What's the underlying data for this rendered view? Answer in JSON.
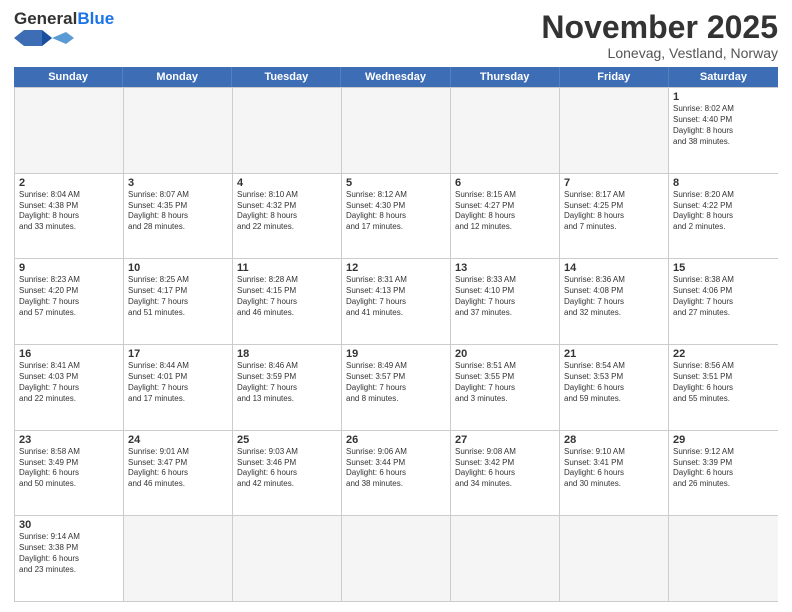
{
  "header": {
    "logo_general": "General",
    "logo_blue": "Blue",
    "title": "November 2025",
    "subtitle": "Lonevag, Vestland, Norway"
  },
  "weekdays": [
    "Sunday",
    "Monday",
    "Tuesday",
    "Wednesday",
    "Thursday",
    "Friday",
    "Saturday"
  ],
  "rows": [
    [
      {
        "day": "",
        "info": ""
      },
      {
        "day": "",
        "info": ""
      },
      {
        "day": "",
        "info": ""
      },
      {
        "day": "",
        "info": ""
      },
      {
        "day": "",
        "info": ""
      },
      {
        "day": "",
        "info": ""
      },
      {
        "day": "1",
        "info": "Sunrise: 8:02 AM\nSunset: 4:40 PM\nDaylight: 8 hours\nand 38 minutes."
      }
    ],
    [
      {
        "day": "2",
        "info": "Sunrise: 8:04 AM\nSunset: 4:38 PM\nDaylight: 8 hours\nand 33 minutes."
      },
      {
        "day": "3",
        "info": "Sunrise: 8:07 AM\nSunset: 4:35 PM\nDaylight: 8 hours\nand 28 minutes."
      },
      {
        "day": "4",
        "info": "Sunrise: 8:10 AM\nSunset: 4:32 PM\nDaylight: 8 hours\nand 22 minutes."
      },
      {
        "day": "5",
        "info": "Sunrise: 8:12 AM\nSunset: 4:30 PM\nDaylight: 8 hours\nand 17 minutes."
      },
      {
        "day": "6",
        "info": "Sunrise: 8:15 AM\nSunset: 4:27 PM\nDaylight: 8 hours\nand 12 minutes."
      },
      {
        "day": "7",
        "info": "Sunrise: 8:17 AM\nSunset: 4:25 PM\nDaylight: 8 hours\nand 7 minutes."
      },
      {
        "day": "8",
        "info": "Sunrise: 8:20 AM\nSunset: 4:22 PM\nDaylight: 8 hours\nand 2 minutes."
      }
    ],
    [
      {
        "day": "9",
        "info": "Sunrise: 8:23 AM\nSunset: 4:20 PM\nDaylight: 7 hours\nand 57 minutes."
      },
      {
        "day": "10",
        "info": "Sunrise: 8:25 AM\nSunset: 4:17 PM\nDaylight: 7 hours\nand 51 minutes."
      },
      {
        "day": "11",
        "info": "Sunrise: 8:28 AM\nSunset: 4:15 PM\nDaylight: 7 hours\nand 46 minutes."
      },
      {
        "day": "12",
        "info": "Sunrise: 8:31 AM\nSunset: 4:13 PM\nDaylight: 7 hours\nand 41 minutes."
      },
      {
        "day": "13",
        "info": "Sunrise: 8:33 AM\nSunset: 4:10 PM\nDaylight: 7 hours\nand 37 minutes."
      },
      {
        "day": "14",
        "info": "Sunrise: 8:36 AM\nSunset: 4:08 PM\nDaylight: 7 hours\nand 32 minutes."
      },
      {
        "day": "15",
        "info": "Sunrise: 8:38 AM\nSunset: 4:06 PM\nDaylight: 7 hours\nand 27 minutes."
      }
    ],
    [
      {
        "day": "16",
        "info": "Sunrise: 8:41 AM\nSunset: 4:03 PM\nDaylight: 7 hours\nand 22 minutes."
      },
      {
        "day": "17",
        "info": "Sunrise: 8:44 AM\nSunset: 4:01 PM\nDaylight: 7 hours\nand 17 minutes."
      },
      {
        "day": "18",
        "info": "Sunrise: 8:46 AM\nSunset: 3:59 PM\nDaylight: 7 hours\nand 13 minutes."
      },
      {
        "day": "19",
        "info": "Sunrise: 8:49 AM\nSunset: 3:57 PM\nDaylight: 7 hours\nand 8 minutes."
      },
      {
        "day": "20",
        "info": "Sunrise: 8:51 AM\nSunset: 3:55 PM\nDaylight: 7 hours\nand 3 minutes."
      },
      {
        "day": "21",
        "info": "Sunrise: 8:54 AM\nSunset: 3:53 PM\nDaylight: 6 hours\nand 59 minutes."
      },
      {
        "day": "22",
        "info": "Sunrise: 8:56 AM\nSunset: 3:51 PM\nDaylight: 6 hours\nand 55 minutes."
      }
    ],
    [
      {
        "day": "23",
        "info": "Sunrise: 8:58 AM\nSunset: 3:49 PM\nDaylight: 6 hours\nand 50 minutes."
      },
      {
        "day": "24",
        "info": "Sunrise: 9:01 AM\nSunset: 3:47 PM\nDaylight: 6 hours\nand 46 minutes."
      },
      {
        "day": "25",
        "info": "Sunrise: 9:03 AM\nSunset: 3:46 PM\nDaylight: 6 hours\nand 42 minutes."
      },
      {
        "day": "26",
        "info": "Sunrise: 9:06 AM\nSunset: 3:44 PM\nDaylight: 6 hours\nand 38 minutes."
      },
      {
        "day": "27",
        "info": "Sunrise: 9:08 AM\nSunset: 3:42 PM\nDaylight: 6 hours\nand 34 minutes."
      },
      {
        "day": "28",
        "info": "Sunrise: 9:10 AM\nSunset: 3:41 PM\nDaylight: 6 hours\nand 30 minutes."
      },
      {
        "day": "29",
        "info": "Sunrise: 9:12 AM\nSunset: 3:39 PM\nDaylight: 6 hours\nand 26 minutes."
      }
    ],
    [
      {
        "day": "30",
        "info": "Sunrise: 9:14 AM\nSunset: 3:38 PM\nDaylight: 6 hours\nand 23 minutes."
      },
      {
        "day": "",
        "info": ""
      },
      {
        "day": "",
        "info": ""
      },
      {
        "day": "",
        "info": ""
      },
      {
        "day": "",
        "info": ""
      },
      {
        "day": "",
        "info": ""
      },
      {
        "day": "",
        "info": ""
      }
    ]
  ]
}
